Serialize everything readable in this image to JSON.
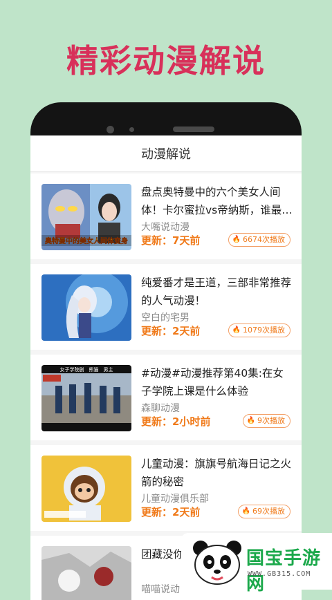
{
  "promo": {
    "title": "精彩动漫解说"
  },
  "app": {
    "header_title": "动漫解说"
  },
  "items": [
    {
      "title": "盘点奥特曼中的六个美女人间体！卡尔蜜拉vs帝纳斯，谁最…",
      "author": "大嘴说动漫",
      "update": "更新：7天前",
      "plays": "6674次播放",
      "thumb_caption": "奥特曼中的美女人间体变身"
    },
    {
      "title": "纯爱番才是王道，三部非常推荐的人气动漫！",
      "author": "空白的宅男",
      "update": "更新：2天前",
      "plays": "1079次播放"
    },
    {
      "title": "#动漫#动漫推荐第40集:在女子学院上课是什么体验",
      "author": "森聊动漫",
      "update": "更新：2小时前",
      "plays": "9次播放",
      "thumb_caption": "女子学院剧　熊猫　男主"
    },
    {
      "title": "儿童动漫：旗旗号航海日记之火箭的秘密",
      "author": "儿童动漫俱乐部",
      "update": "更新：2天前",
      "plays": "69次播放"
    },
    {
      "title": "团藏没你带土和香",
      "author": "喵喵说动",
      "update": "",
      "plays": ""
    }
  ],
  "watermark": {
    "name": "国宝手游网",
    "url": "WWW.GB315.COM"
  },
  "colors": {
    "accent": "#f07a1a",
    "promo": "#d8305a",
    "background": "#bfe4c9"
  }
}
